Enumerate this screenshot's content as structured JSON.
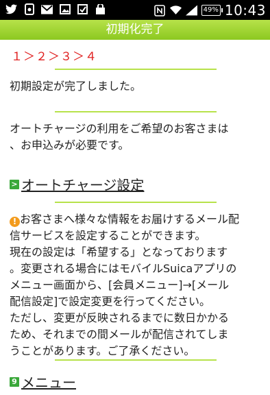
{
  "status_bar": {
    "icons": [
      "twitter-icon",
      "evernote-icon",
      "mail-icon",
      "image-icon",
      "checkbox-icon",
      "shopping-bag-icon"
    ],
    "right_icons": [
      "nfc-icon",
      "wifi-icon",
      "signal-icon"
    ],
    "battery": "49%",
    "time": "10:43"
  },
  "header": {
    "title": "初期化完了"
  },
  "steps": "１＞２＞３＞４",
  "message1": "初期設定が完了しました。",
  "message2_line1": "オートチャージの利用をご希望のお客さまは",
  "message2_line2": "、お申込みが必要です。",
  "section1": {
    "label": "オートチャージ設定",
    "badge": ">"
  },
  "notice": {
    "lines": [
      "お客さまへ様々な情報をお届けするメール配",
      "信サービスを設定することができます。",
      "現在の設定は「希望する」となっております",
      "。変更される場合にはモバイルSuicaアプリの",
      "メニュー画面から、[会員メニュー]→[メール",
      "配信設定]で設定変更を行ってください。",
      "ただし、変更が反映されるまでに数日かかる",
      "ため、それまでの間メールが配信されてしま",
      "うことがあります。ご了承ください。"
    ]
  },
  "section2": {
    "label": "メニュー",
    "badge": "9"
  },
  "colors": {
    "accent": "#8cc820",
    "steps": "#e02020",
    "warn": "#f39b1c",
    "badge": "#3aa83a"
  }
}
